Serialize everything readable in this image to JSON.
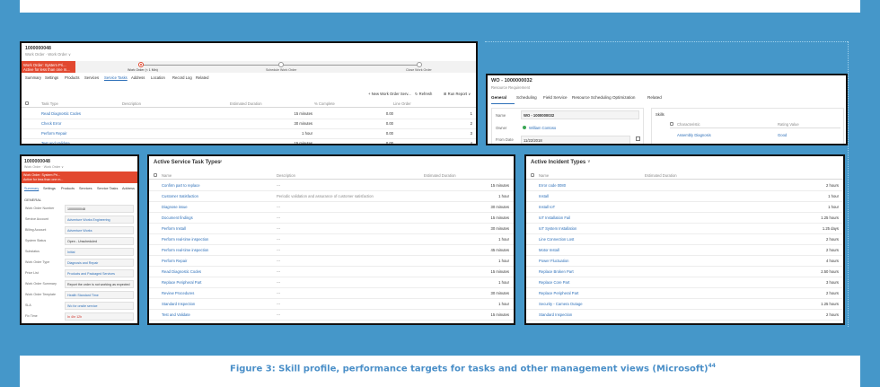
{
  "panel1": {
    "wo_number": "1000000048",
    "subtitle": "Work Order · Work Order ∨",
    "red_line1": "Work Order: System Pri...",
    "red_line2": "Active for less than one m...",
    "stage1": "Work Order (< 1 Min)",
    "stage2": "Schedule Work Order",
    "stage3": "Close Work Order",
    "tabs": [
      "Summary",
      "Settings",
      "Products",
      "Services",
      "Service Tasks",
      "Address",
      "Location",
      "Record Log",
      "Related"
    ],
    "toolbar": [
      "+ New Work Order Serv...",
      "↻ Refresh",
      "⊞ Run Report ∨"
    ],
    "columns": [
      "Task Type",
      "Description",
      "Estimated Duration",
      "% Complete",
      "Line Order"
    ],
    "rows": [
      {
        "task": "Read Diagnostic Codes",
        "duration": "15 minutes",
        "pct": "0.00",
        "order": "1"
      },
      {
        "task": "Check Error",
        "duration": "30 minutes",
        "pct": "0.00",
        "order": "2"
      },
      {
        "task": "Perform Repair",
        "duration": "1 hour",
        "pct": "0.00",
        "order": "3"
      },
      {
        "task": "Test and Validate",
        "duration": "15 minutes",
        "pct": "0.00",
        "order": "4"
      }
    ]
  },
  "panel2": {
    "title": "WO - 1000000032",
    "subtitle": "Resource Requirement",
    "tabs": [
      "General",
      "Scheduling",
      "Field Service",
      "Resource Scheduling Optimization",
      "Related"
    ],
    "fields": [
      {
        "label": "Name",
        "value": "WO - 1000000032"
      },
      {
        "label": "Owner",
        "value": "William Contoso"
      },
      {
        "label": "From Date",
        "value": "11/22/2018"
      }
    ],
    "skills_label": "Skills",
    "skills_header": "Characteristic",
    "skills_header2": "Rating Value",
    "skill_name": "Assembly Diagnosis",
    "skill_rating": "Good"
  },
  "panel3": {
    "wo_number": "1000000048",
    "subtitle": "Work Order · Work Order ∨",
    "red_line1": "Work Order: System Pri...",
    "red_line2": "Active for less than one m...",
    "tabs": [
      "Summary",
      "Settings",
      "Products",
      "Services",
      "Service Tasks",
      "Address"
    ],
    "section": "GENERAL",
    "fields": [
      {
        "label": "Work Order Number",
        "value": "1000000048"
      },
      {
        "label": "Service Account",
        "value": "Adventure Works Engineering"
      },
      {
        "label": "Billing Account",
        "value": "Adventure Works"
      },
      {
        "label": "System Status",
        "value": "Open - Unscheduled"
      },
      {
        "label": "Substatus",
        "value": "Initial"
      },
      {
        "label": "Work Order Type",
        "value": "Diagnosis and Repair"
      },
      {
        "label": "Price List",
        "value": "Products and Packaged Services"
      },
      {
        "label": "Work Order Summary",
        "value": "Report the order is not working as expected"
      },
      {
        "label": "Work Order Template",
        "value": "Health Standard Time"
      },
      {
        "label": "SLA",
        "value": "Wo for onsite service"
      },
      {
        "label": "Fix Time",
        "value": "In 4hr 12h"
      }
    ]
  },
  "panel4": {
    "title": "Active Service Task Types",
    "columns": [
      "Name",
      "Description",
      "Estimated Duration"
    ],
    "rows": [
      {
        "name": "Confirm part to replace",
        "desc": "---",
        "duration": "15 minutes"
      },
      {
        "name": "Customer Satisfaction",
        "desc": "Periodic validation and assurance of customer satisfaction",
        "duration": "1 hour"
      },
      {
        "name": "Diagnose issue",
        "desc": "---",
        "duration": "30 minutes"
      },
      {
        "name": "Document findings",
        "desc": "---",
        "duration": "15 minutes"
      },
      {
        "name": "Perform Install",
        "desc": "---",
        "duration": "30 minutes"
      },
      {
        "name": "Perform real-time inspection",
        "desc": "---",
        "duration": "1 hour"
      },
      {
        "name": "Perform real-time inspection",
        "desc": "---",
        "duration": "45 minutes"
      },
      {
        "name": "Perform Repair",
        "desc": "---",
        "duration": "1 hour"
      },
      {
        "name": "Read Diagnostic Codes",
        "desc": "---",
        "duration": "15 minutes"
      },
      {
        "name": "Replace Peripheral Part",
        "desc": "---",
        "duration": "1 hour"
      },
      {
        "name": "Review Procedures",
        "desc": "---",
        "duration": "30 minutes"
      },
      {
        "name": "Standard Inspection",
        "desc": "---",
        "duration": "1 hour"
      },
      {
        "name": "Test and Validate",
        "desc": "---",
        "duration": "15 minutes"
      }
    ]
  },
  "panel5": {
    "title": "Active Incident Types",
    "columns": [
      "Name",
      "Estimated Duration"
    ],
    "rows": [
      {
        "name": "Error code 0080",
        "duration": "2 hours"
      },
      {
        "name": "Install",
        "duration": "1 hour"
      },
      {
        "name": "Install IoT",
        "duration": "1 hour"
      },
      {
        "name": "IoT Installation Fail",
        "duration": "1.25 hours"
      },
      {
        "name": "IoT System Installation",
        "duration": "1.25 days"
      },
      {
        "name": "Line Connection Lost",
        "duration": "2 hours"
      },
      {
        "name": "Motor Install",
        "duration": "2 hours"
      },
      {
        "name": "Power Fluctuation",
        "duration": "4 hours"
      },
      {
        "name": "Replace Broken Part",
        "duration": "2.50 hours"
      },
      {
        "name": "Replace Core Part",
        "duration": "3 hours"
      },
      {
        "name": "Replace Peripheral Part",
        "duration": "2 hours"
      },
      {
        "name": "Security - Camera Outage",
        "duration": "1.25 hours"
      },
      {
        "name": "Standard Inspection",
        "duration": "2 hours"
      }
    ]
  },
  "caption": {
    "text": "Figure 3: Skill profile, performance targets for tasks and other management views (Microsoft)",
    "ref": "44"
  }
}
